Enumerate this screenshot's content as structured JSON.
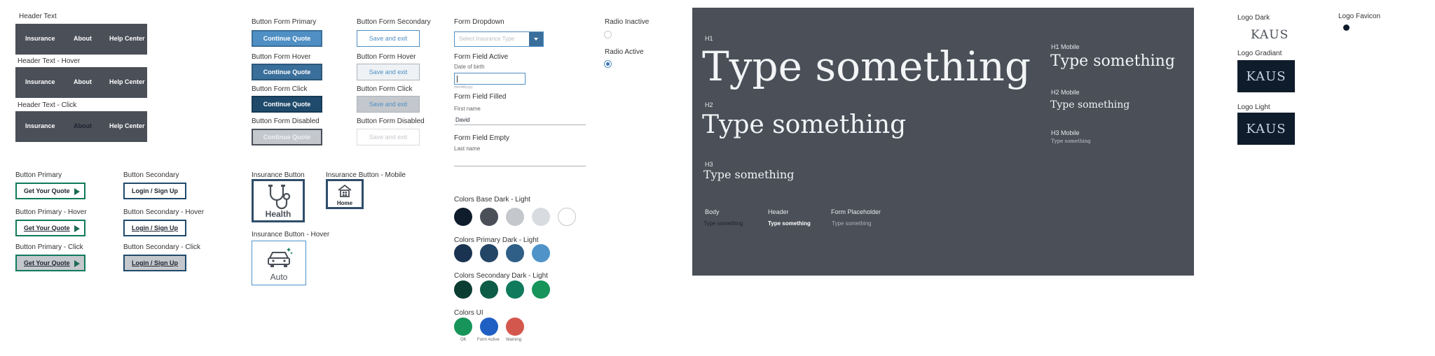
{
  "header_nav": {
    "label_default": "Header Text",
    "label_hover": "Header Text - Hover",
    "label_click": "Header Text - Click",
    "items": [
      "Insurance",
      "About",
      "Help Center"
    ]
  },
  "cta": {
    "primary_label": "Button Primary",
    "primary_hover_label": "Button Primary - Hover",
    "primary_click_label": "Button Primary - Click",
    "primary_text": "Get Your Quote",
    "secondary_label": "Button Secondary",
    "secondary_hover_label": "Button Secondary - Hover",
    "secondary_click_label": "Button Secondary - Click",
    "secondary_text": "Login / Sign Up"
  },
  "form_buttons": {
    "primary_label": "Button Form Primary",
    "hover_label": "Button Form Hover",
    "click_label": "Button Form Click",
    "disabled_label": "Button Form Disabled",
    "primary_text": "Continue Quote",
    "secondary_label": "Button Form Secondary",
    "secondary_hover_label": "Button Form Hover",
    "secondary_click_label": "Button Form Click",
    "secondary_disabled_label": "Button Form Disabled",
    "secondary_text": "Save and exit"
  },
  "insurance_buttons": {
    "label": "Insurance Button",
    "mobile_label": "Insurance Button - Mobile",
    "hover_label": "Insurance Button - Hover",
    "health": "Health",
    "home": "Home",
    "auto": "Auto"
  },
  "form": {
    "dropdown_label": "Form Dropdown",
    "dropdown_placeholder": "Select Insurance Type",
    "active_label": "Form Field Active",
    "active_field_label": "Date of birth",
    "active_field_hint": "mm/dd/yyyy",
    "filled_label": "Form Field Filled",
    "filled_field_label": "First name",
    "filled_value": "David",
    "empty_label": "Form Field Empty",
    "empty_field_label": "Last name"
  },
  "radio": {
    "inactive_label": "Radio Inactive",
    "active_label": "Radio Active"
  },
  "colors": {
    "base_label": "Colors Base Dark - Light",
    "base": [
      "#0f1c2b",
      "#4a4f58",
      "#c4c8cd",
      "#d8dce0",
      "#ffffff"
    ],
    "primary_label": "Colors Primary Dark - Light",
    "primary": [
      "#1a3350",
      "#234566",
      "#2f5f86",
      "#4f93c8"
    ],
    "secondary_label": "Colors Secondary Dark - Light",
    "secondary": [
      "#0b3d33",
      "#0d5c48",
      "#0f7a5c",
      "#16945a"
    ],
    "ui_label": "Colors UI",
    "ui": [
      "#16945a",
      "#1f5fc4",
      "#d4574d"
    ],
    "ui_names": [
      "OK",
      "Form Active",
      "Warning"
    ]
  },
  "typography": {
    "h1_label": "H1",
    "h2_label": "H2",
    "h3_label": "H3",
    "h1_mobile_label": "H1 Mobile",
    "h2_mobile_label": "H2 Mobile",
    "h3_mobile_label": "H3 Mobile",
    "sample": "Type something",
    "body_label": "Body",
    "header_label": "Header",
    "placeholder_label": "Form Placeholder"
  },
  "logos": {
    "dark_label": "Logo Dark",
    "gradient_label": "Logo Gradiant",
    "light_label": "Logo Light",
    "favicon_label": "Logo Favicon",
    "wordmark": "KAUS"
  }
}
